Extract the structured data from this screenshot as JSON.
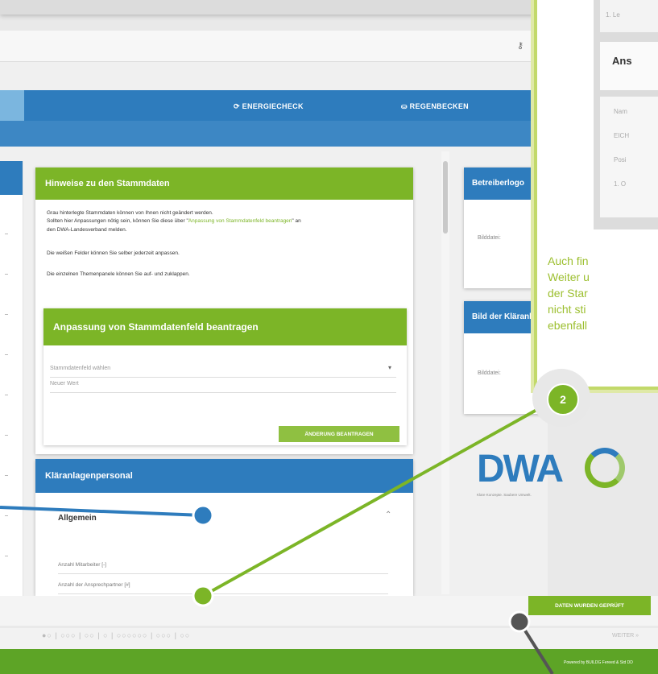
{
  "nav": {
    "energie": "⟳ ENERGIECHECK",
    "regen": "⛀ REGENBECKEN"
  },
  "hinweise": {
    "title": "Hinweise zu den Stammdaten",
    "line1": "Grau hinterlegte Stammdaten können von Ihnen nicht geändert werden.",
    "line2_a": "Sollten hier Anpassungen nötig sein, können Sie diese über \"",
    "line2_link": "Anpassung von Stammdatenfeld beantragen",
    "line2_b": "\" an",
    "line3": "den DWA-Landesverband melden.",
    "line4": "Die weißen Felder können Sie selber jederzeit anpassen.",
    "line5": "Die einzelnen Themenpanele können Sie auf- und zuklappen."
  },
  "anpassung": {
    "title": "Anpassung von Stammdatenfeld beantragen",
    "select_placeholder": "Stammdatenfeld wählen",
    "new_value_placeholder": "Neuer Wert",
    "button": "ÄNDERUNG BEANTRAGEN"
  },
  "personal": {
    "title": "Kläranlagenpersonal",
    "section": "Allgemein",
    "field1": "Anzahl Mitarbeiter [-]",
    "field2": "Anzahl der Ansprechpartner [#]"
  },
  "right": {
    "betreiber_title": "Betreiberlogo",
    "betreiber_bild": "Bilddatei:",
    "bild_title": "Bild der Kläranlage",
    "bild_bild": "Bilddatei:",
    "logo_text": "DWA",
    "slogan": "Klare Konzepte. Saubere Umwelt."
  },
  "footer": {
    "daten_button": "DATEN WURDEN GEPRÜFT",
    "weiter": "WEITER »",
    "powered": "Powered by BUILDG Fereed & Std DD",
    "pager": "●○ | ○○○ | ○○ | ○ | ○○○○○○ | ○○○ | ○○"
  },
  "callout": {
    "heading": "Ans",
    "line_a": "1. Le",
    "name_label": "Nam",
    "name_value": "EICH",
    "pos_label": "Posi",
    "pos_value": "1. O",
    "text": [
      "Auch fin",
      "Weiter u",
      "der Star",
      "nicht sti",
      "ebenfall"
    ],
    "badge": "2"
  },
  "colors": {
    "green": "#7cb527",
    "blue": "#2e7cbd",
    "callout_text": "#9cbf2f"
  }
}
